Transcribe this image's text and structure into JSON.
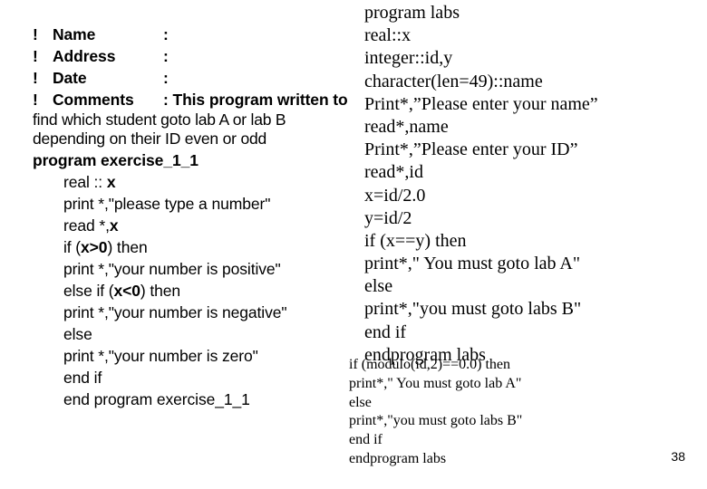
{
  "slide": {
    "page_number": "38",
    "background_color": "#ffffff",
    "text_color": "#000000"
  },
  "left_column": {
    "header_rows": [
      {
        "bang": "!",
        "key": "Name",
        "colon": ":",
        "value": ""
      },
      {
        "bang": "!",
        "key": "Address",
        "colon": ":",
        "value": ""
      },
      {
        "bang": "!",
        "key": "Date",
        "colon": ":",
        "value": ""
      }
    ],
    "comments_row": {
      "bang": "!",
      "key": "Comments",
      "colon_value": ": This program written to"
    },
    "comments_wrapped": "find which student goto lab A or lab B depending on their ID even or odd",
    "program_header": "program exercise_1_1",
    "code_lines": [
      {
        "pre": "real :: ",
        "bold": "x",
        "post": ""
      },
      {
        "pre": "print *,\"please type a number\"",
        "bold": "",
        "post": ""
      },
      {
        "pre": "read *,",
        "bold": "x",
        "post": ""
      },
      {
        "pre": "if (",
        "bold": "x>0",
        "post": ") then"
      },
      {
        "pre": "print *,\"your number is positive\"",
        "bold": "",
        "post": ""
      },
      {
        "pre": "else if (",
        "bold": "x<0",
        "post": ") then"
      },
      {
        "pre": "print *,\"your number is negative\"",
        "bold": "",
        "post": ""
      },
      {
        "pre": "else",
        "bold": "",
        "post": ""
      },
      {
        "pre": "print *,\"your number is zero\"",
        "bold": "",
        "post": ""
      },
      {
        "pre": "end if",
        "bold": "",
        "post": ""
      },
      {
        "pre": "end program exercise_1_1",
        "bold": "",
        "post": ""
      }
    ]
  },
  "right_column": {
    "lines": [
      "program labs",
      "real::x",
      "integer::id,y",
      "character(len=49)::name",
      "Print*,”Please enter your name”",
      "read*,name",
      "Print*,”Please enter your ID”",
      "read*,id",
      "x=id/2.0",
      "y=id/2",
      "if (x==y) then",
      "print*,\" You must goto lab A\"",
      "else",
      "print*,\"you must goto labs B\"",
      "end if",
      "endprogram labs"
    ]
  },
  "right_small_block": {
    "lines": [
      "if (modulo(id,2)==0.0) then",
      "print*,\" You must goto lab A\"",
      "else",
      "print*,\"you must goto labs B\"",
      "end if",
      "endprogram labs"
    ]
  }
}
